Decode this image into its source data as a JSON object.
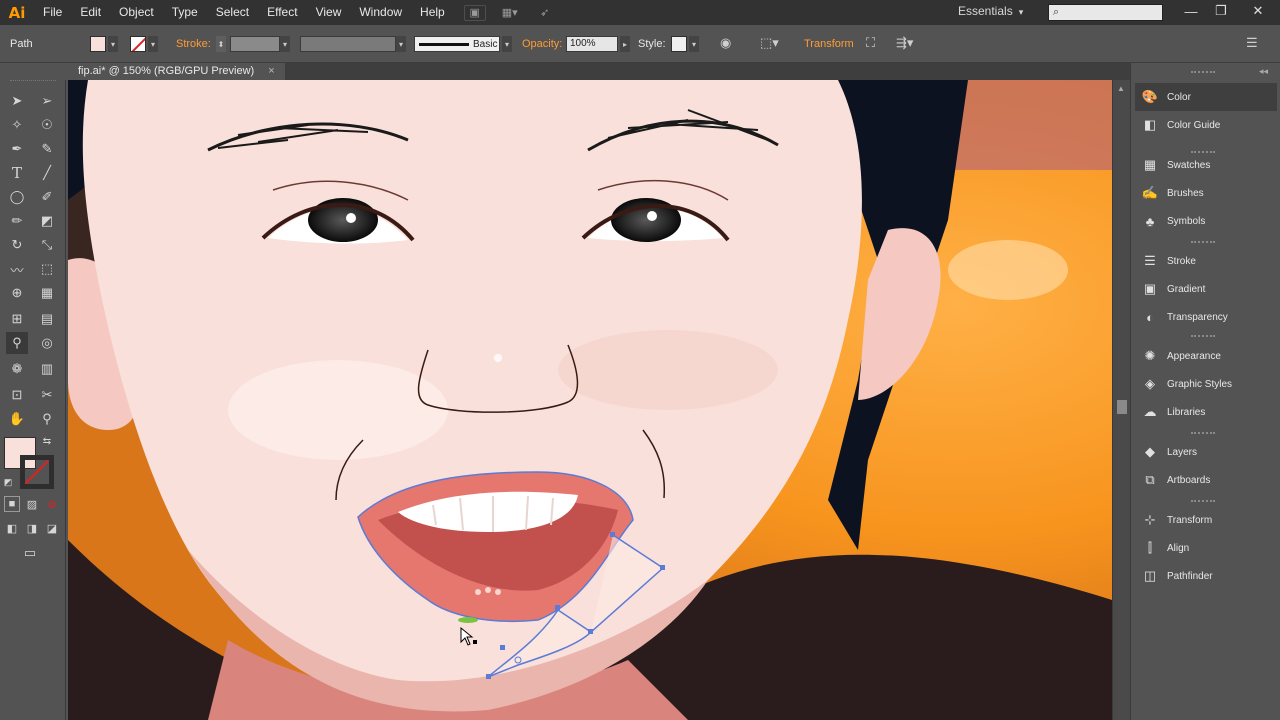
{
  "app": {
    "logo": "Ai"
  },
  "menu": [
    "File",
    "Edit",
    "Object",
    "Type",
    "Select",
    "Effect",
    "View",
    "Window",
    "Help"
  ],
  "workspace": {
    "label": "Essentials",
    "chevron": "▾"
  },
  "search": {
    "placeholder": ""
  },
  "window_controls": [
    "—",
    "❐",
    "✕"
  ],
  "controlbar": {
    "selection_label": "Path",
    "fill_color": "#f9e0da",
    "stroke_label": "Stroke:",
    "brush_label": "Basic",
    "opacity_label": "Opacity:",
    "opacity_value": "100%",
    "style_label": "Style:",
    "transform_label": "Transform"
  },
  "document": {
    "tab_title": "fip.ai* @ 150% (RGB/GPU Preview)",
    "close": "×"
  },
  "toolbar": {
    "tools": [
      "selection-tool",
      "direct-selection-tool",
      "magic-wand-tool",
      "lasso-tool",
      "pen-tool",
      "curvature-tool",
      "type-tool",
      "line-tool",
      "ellipse-tool",
      "paintbrush-tool",
      "pencil-tool",
      "eraser-tool",
      "rotate-tool",
      "scale-tool",
      "warp-tool",
      "free-transform-tool",
      "shape-builder-tool",
      "perspective-grid-tool",
      "mesh-tool",
      "gradient-tool",
      "eyedropper-tool",
      "blend-tool",
      "symbol-sprayer-tool",
      "column-graph-tool",
      "artboard-tool",
      "slice-tool",
      "hand-tool",
      "zoom-tool"
    ],
    "fill_color": "#f9e0da"
  },
  "panels": {
    "groups": [
      [
        "Color",
        "Color Guide"
      ],
      [
        "Swatches",
        "Brushes",
        "Symbols"
      ],
      [
        "Stroke",
        "Gradient",
        "Transparency"
      ],
      [
        "Appearance",
        "Graphic Styles",
        "Libraries"
      ],
      [
        "Layers",
        "Artboards"
      ],
      [
        "Transform",
        "Align",
        "Pathfinder"
      ]
    ]
  },
  "colors": {
    "skin": "#f9e0da",
    "hair": "#0d1220",
    "lips": "#e5776f",
    "background_orange": "#ff9f2a",
    "shirt": "#2a1c1c",
    "selection_blue": "#5b7bd6",
    "accent_orange": "#ff9c36"
  }
}
